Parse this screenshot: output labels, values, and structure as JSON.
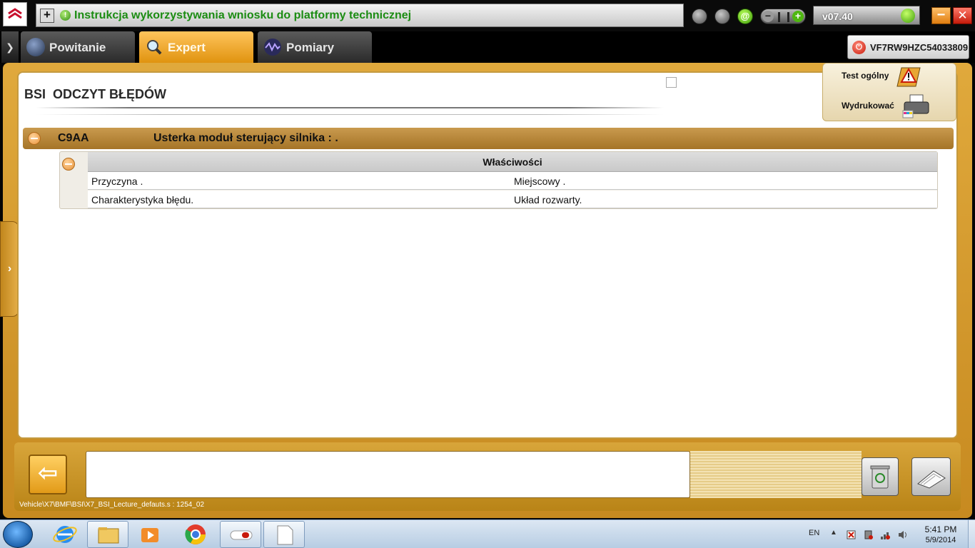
{
  "app": {
    "title": "Instrukcja wykorzystywania wniosku do platformy technicznej",
    "version": "v07.40",
    "colors": {
      "gold": "#e0a93c",
      "tab_active": "#f2b23a",
      "title_green": "#1b8c12",
      "fault_row": "#b58332"
    },
    "title_icons": [
      "add-icon",
      "info-icon",
      "download-icon",
      "user-icon",
      "email-icon",
      "signal-icon"
    ]
  },
  "tabs": [
    {
      "label": "Powitanie",
      "icon": "welcome-icon",
      "active": false
    },
    {
      "label": "Expert",
      "icon": "magnifier-icon",
      "active": true
    },
    {
      "label": "Pomiary",
      "icon": "waveform-icon",
      "active": false
    }
  ],
  "vehicle": {
    "vin": "VF7RW9HZC54033809"
  },
  "page": {
    "title": "BSI  ODCZYT BŁĘDÓW"
  },
  "actions": {
    "general_test": "Test ogólny",
    "print": "Wydrukować"
  },
  "fault": {
    "code": "C9AA",
    "description": "Usterka moduł sterujący silnika : .",
    "properties_header": "Właściwości",
    "properties": [
      {
        "key": "Przyczyna .",
        "value": "Miejscowy ."
      },
      {
        "key": "Charakterystyka błędu.",
        "value": "Układ rozwarty."
      }
    ]
  },
  "footer": {
    "path": "Vehicle\\X7\\BMF\\BSI\\X7_BSI_Lecture_defauts.s : 1254_02"
  },
  "taskbar": {
    "apps": [
      "ie-icon",
      "explorer-icon",
      "media-player-icon",
      "chrome-icon",
      "diagbox-icon",
      "document-icon"
    ],
    "language": "EN",
    "time": "5:41 PM",
    "date": "5/9/2014"
  }
}
